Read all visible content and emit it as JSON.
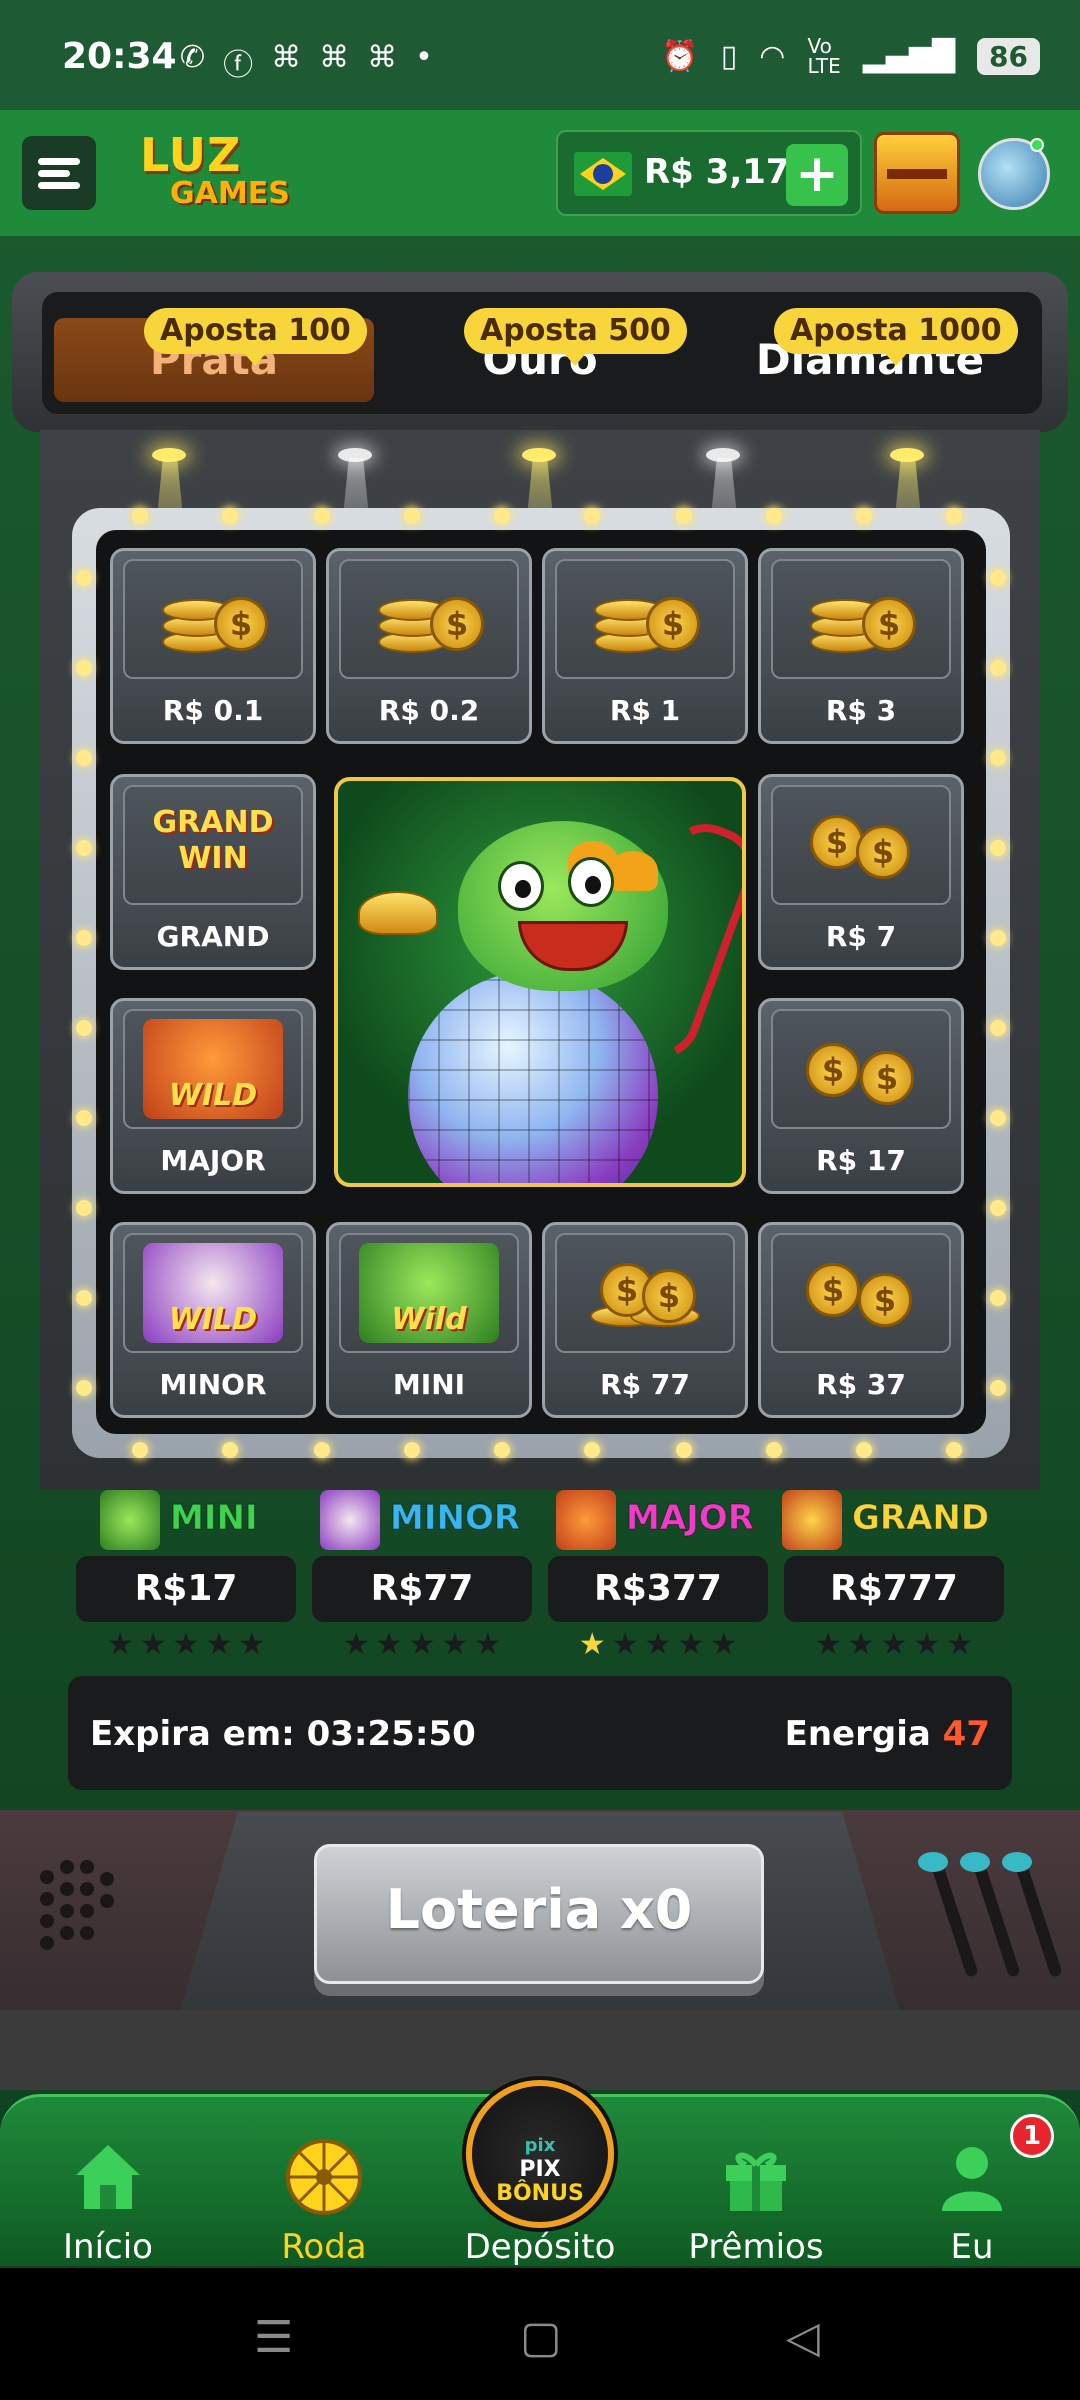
{
  "status_bar": {
    "time": "20:34",
    "left_icons": [
      "whatsapp-icon",
      "facebook-icon",
      "app-icon",
      "app-icon",
      "app-icon",
      "dot"
    ],
    "battery": "86"
  },
  "header": {
    "logo_top": "LUZ",
    "logo_bottom": "GAMES",
    "balance": "R$ 3,17",
    "plus_label": "+"
  },
  "tabs": [
    {
      "label": "Prata",
      "badge": "Aposta 100",
      "active": true
    },
    {
      "label": "Ouro",
      "badge": "Aposta 500",
      "active": false
    },
    {
      "label": "Diamante",
      "badge": "Aposta 1000",
      "active": false
    }
  ],
  "grid": {
    "row1": [
      "R$ 0.1",
      "R$ 0.2",
      "R$ 1",
      "R$ 3"
    ],
    "grand_label": "GRAND",
    "grand_art_line1": "GRAND",
    "grand_art_line2": "WIN",
    "major_label": "MAJOR",
    "r7_label": "R$ 7",
    "r17_label": "R$ 17",
    "bottom_row": [
      "MINOR",
      "MINI",
      "R$ 77",
      "R$ 37"
    ],
    "wild_text": "WILD",
    "wild_text_alt": "Wild"
  },
  "jackpots": [
    {
      "name": "MINI",
      "value": "R$17",
      "color": "#3fd24f",
      "stars_filled": 0
    },
    {
      "name": "MINOR",
      "value": "R$77",
      "color": "#38b6f0",
      "stars_filled": 0
    },
    {
      "name": "MAJOR",
      "value": "R$377",
      "color": "#f03cc8",
      "stars_filled": 1
    },
    {
      "name": "GRAND",
      "value": "R$777",
      "color": "#f7d53b",
      "stars_filled": 0
    }
  ],
  "info": {
    "expira": "Expira em: 03:25:50",
    "energia_label": "Energia",
    "energia_value": "47"
  },
  "loteria_button": "Loteria x0",
  "bottom_nav": {
    "items": [
      {
        "label": "Início"
      },
      {
        "label": "Roda"
      },
      {
        "label": "Depósito"
      },
      {
        "label": "Prêmios"
      },
      {
        "label": "Eu"
      }
    ],
    "pix_line1": "pix",
    "pix_line2": "PIX",
    "pix_line3": "BÔNUS",
    "badge": "1"
  }
}
